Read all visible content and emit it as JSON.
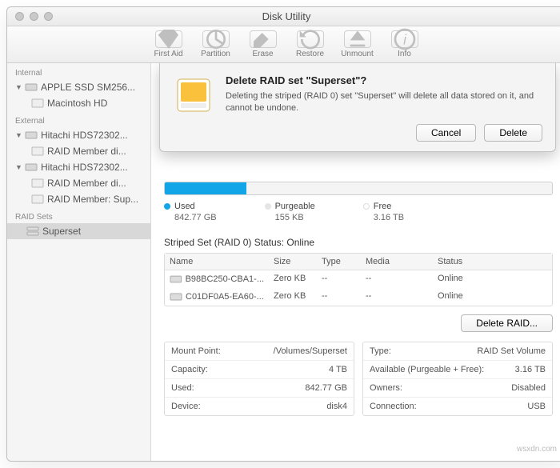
{
  "title": "Disk Utility",
  "toolbar": [
    {
      "label": "First Aid",
      "icon": "firstaid"
    },
    {
      "label": "Partition",
      "icon": "partition"
    },
    {
      "label": "Erase",
      "icon": "erase"
    },
    {
      "label": "Restore",
      "icon": "restore"
    },
    {
      "label": "Unmount",
      "icon": "unmount"
    },
    {
      "label": "Info",
      "icon": "info"
    }
  ],
  "sidebar": {
    "sections": [
      {
        "header": "Internal",
        "items": [
          {
            "label": "APPLE SSD SM256...",
            "kind": "disk",
            "expanded": true,
            "children": [
              {
                "label": "Macintosh HD",
                "kind": "vol"
              }
            ]
          }
        ]
      },
      {
        "header": "External",
        "items": [
          {
            "label": "Hitachi HDS72302...",
            "kind": "disk",
            "expanded": true,
            "children": [
              {
                "label": "RAID Member di...",
                "kind": "vol"
              }
            ]
          },
          {
            "label": "Hitachi HDS72302...",
            "kind": "disk",
            "expanded": true,
            "children": [
              {
                "label": "RAID Member di...",
                "kind": "vol"
              },
              {
                "label": "RAID Member: Sup...",
                "kind": "vol"
              }
            ]
          }
        ]
      },
      {
        "header": "RAID Sets",
        "items": [
          {
            "label": "Superset",
            "kind": "raid",
            "selected": true
          }
        ]
      }
    ]
  },
  "dialog": {
    "title": "Delete RAID set \"Superset\"?",
    "message": "Deleting the striped (RAID 0) set \"Superset\" will delete all data stored on it, and cannot be undone.",
    "cancel": "Cancel",
    "delete": "Delete"
  },
  "usage": {
    "used": {
      "label": "Used",
      "value": "842.77 GB",
      "color": "#12a6e8"
    },
    "purgeable": {
      "label": "Purgeable",
      "value": "155 KB",
      "color": "#e5e5e5"
    },
    "free": {
      "label": "Free",
      "value": "3.16 TB",
      "color": "#f4f4f4"
    }
  },
  "raidStatus": "Striped Set (RAID 0) Status: Online",
  "table": {
    "headers": {
      "name": "Name",
      "size": "Size",
      "type": "Type",
      "media": "Media",
      "status": "Status"
    },
    "rows": [
      {
        "name": "B98BC250-CBA1-...",
        "size": "Zero KB",
        "type": "--",
        "media": "--",
        "status": "Online"
      },
      {
        "name": "C01DF0A5-EA60-...",
        "size": "Zero KB",
        "type": "--",
        "media": "--",
        "status": "Online"
      }
    ],
    "deleteBtn": "Delete RAID..."
  },
  "info": {
    "left": [
      {
        "k": "Mount Point:",
        "v": "/Volumes/Superset"
      },
      {
        "k": "Capacity:",
        "v": "4 TB"
      },
      {
        "k": "Used:",
        "v": "842.77 GB"
      },
      {
        "k": "Device:",
        "v": "disk4"
      }
    ],
    "right": [
      {
        "k": "Type:",
        "v": "RAID Set Volume"
      },
      {
        "k": "Available (Purgeable + Free):",
        "v": "3.16 TB"
      },
      {
        "k": "Owners:",
        "v": "Disabled"
      },
      {
        "k": "Connection:",
        "v": "USB"
      }
    ]
  },
  "watermark": "wsxdn.com"
}
